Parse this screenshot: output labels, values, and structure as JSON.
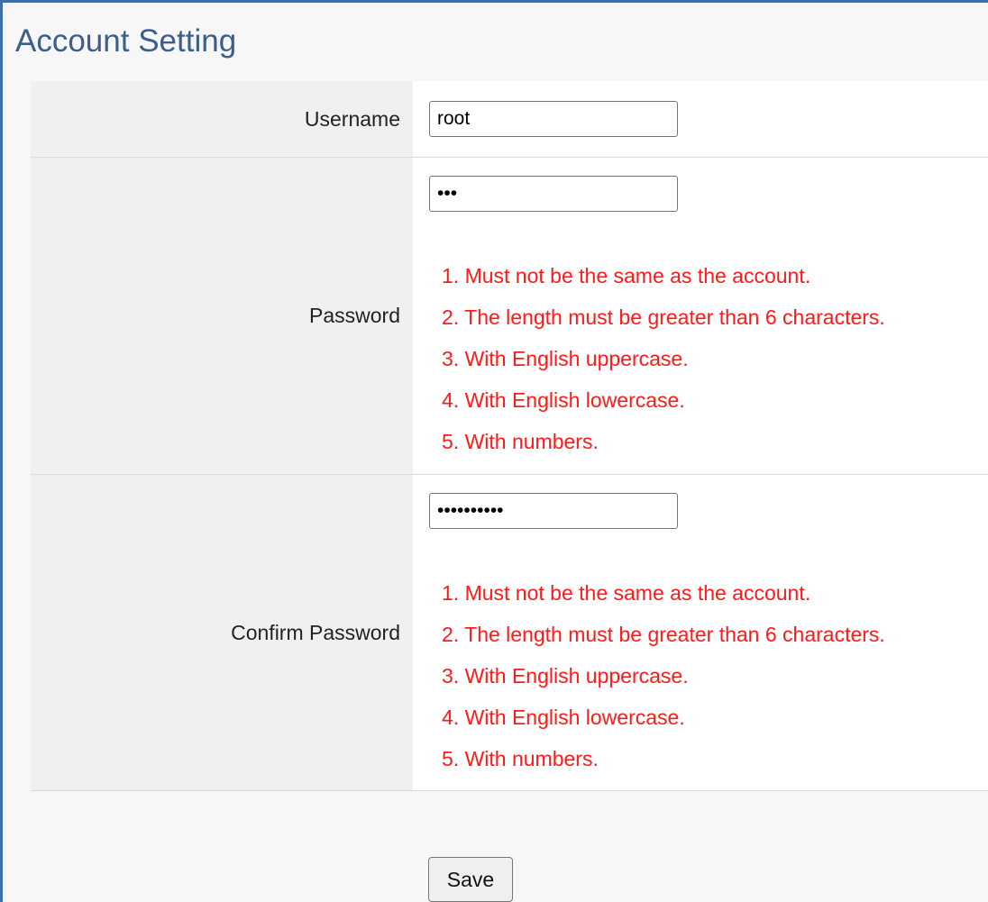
{
  "page": {
    "title": "Account Setting"
  },
  "username": {
    "label": "Username",
    "value": "root"
  },
  "password": {
    "label": "Password",
    "value": "abc",
    "rules": [
      "1. Must not be the same as the account.",
      "2. The length must be greater than 6 characters.",
      "3. With English uppercase.",
      "4. With English lowercase.",
      "5. With numbers."
    ]
  },
  "confirm_password": {
    "label": "Confirm Password",
    "value": "abcdefghij",
    "rules": [
      "1. Must not be the same as the account.",
      "2. The length must be greater than 6 characters.",
      "3. With English uppercase.",
      "4. With English lowercase.",
      "5. With numbers."
    ]
  },
  "actions": {
    "save_label": "Save"
  },
  "colors": {
    "title": "#3b5f8a",
    "rule_text": "#ff1a1a",
    "frame": "#3f6fa8"
  }
}
